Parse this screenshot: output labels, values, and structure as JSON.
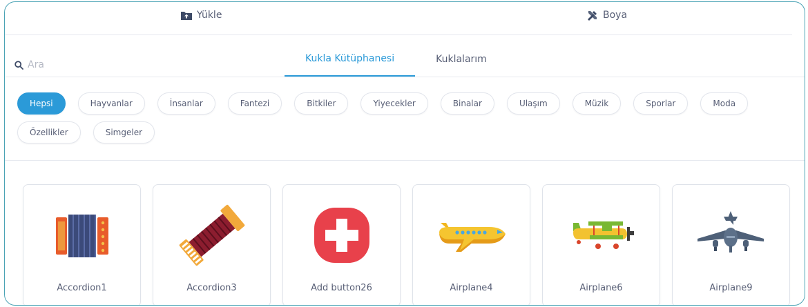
{
  "top_actions": {
    "upload": {
      "label": "Yükle",
      "icon": "upload-folder-icon"
    },
    "paint": {
      "label": "Boya",
      "icon": "paint-brush-icon"
    }
  },
  "search": {
    "placeholder": "Ara",
    "value": "",
    "icon": "search-icon"
  },
  "tabs": [
    {
      "label": "Kukla Kütüphanesi",
      "active": true
    },
    {
      "label": "Kuklalarım",
      "active": false
    }
  ],
  "categories": [
    {
      "label": "Hepsi",
      "active": true
    },
    {
      "label": "Hayvanlar"
    },
    {
      "label": "İnsanlar"
    },
    {
      "label": "Fantezi"
    },
    {
      "label": "Bitkiler"
    },
    {
      "label": "Yiyecekler"
    },
    {
      "label": "Binalar"
    },
    {
      "label": "Ulaşım"
    },
    {
      "label": "Müzik"
    },
    {
      "label": "Sporlar"
    },
    {
      "label": "Moda"
    },
    {
      "label": "Özellikler"
    },
    {
      "label": "Simgeler"
    }
  ],
  "sprites": [
    {
      "name": "Accordion1",
      "icon": "accordion-icon"
    },
    {
      "name": "Accordion3",
      "icon": "accordion-icon"
    },
    {
      "name": "Add button26",
      "icon": "add-button-icon"
    },
    {
      "name": "Airplane4",
      "icon": "airplane-icon"
    },
    {
      "name": "Airplane6",
      "icon": "biplane-icon"
    },
    {
      "name": "Airplane9",
      "icon": "airplane-icon"
    }
  ],
  "colors": {
    "accent": "#2b9ad8",
    "frame_border": "#4ba3b5",
    "text": "#575e75"
  }
}
